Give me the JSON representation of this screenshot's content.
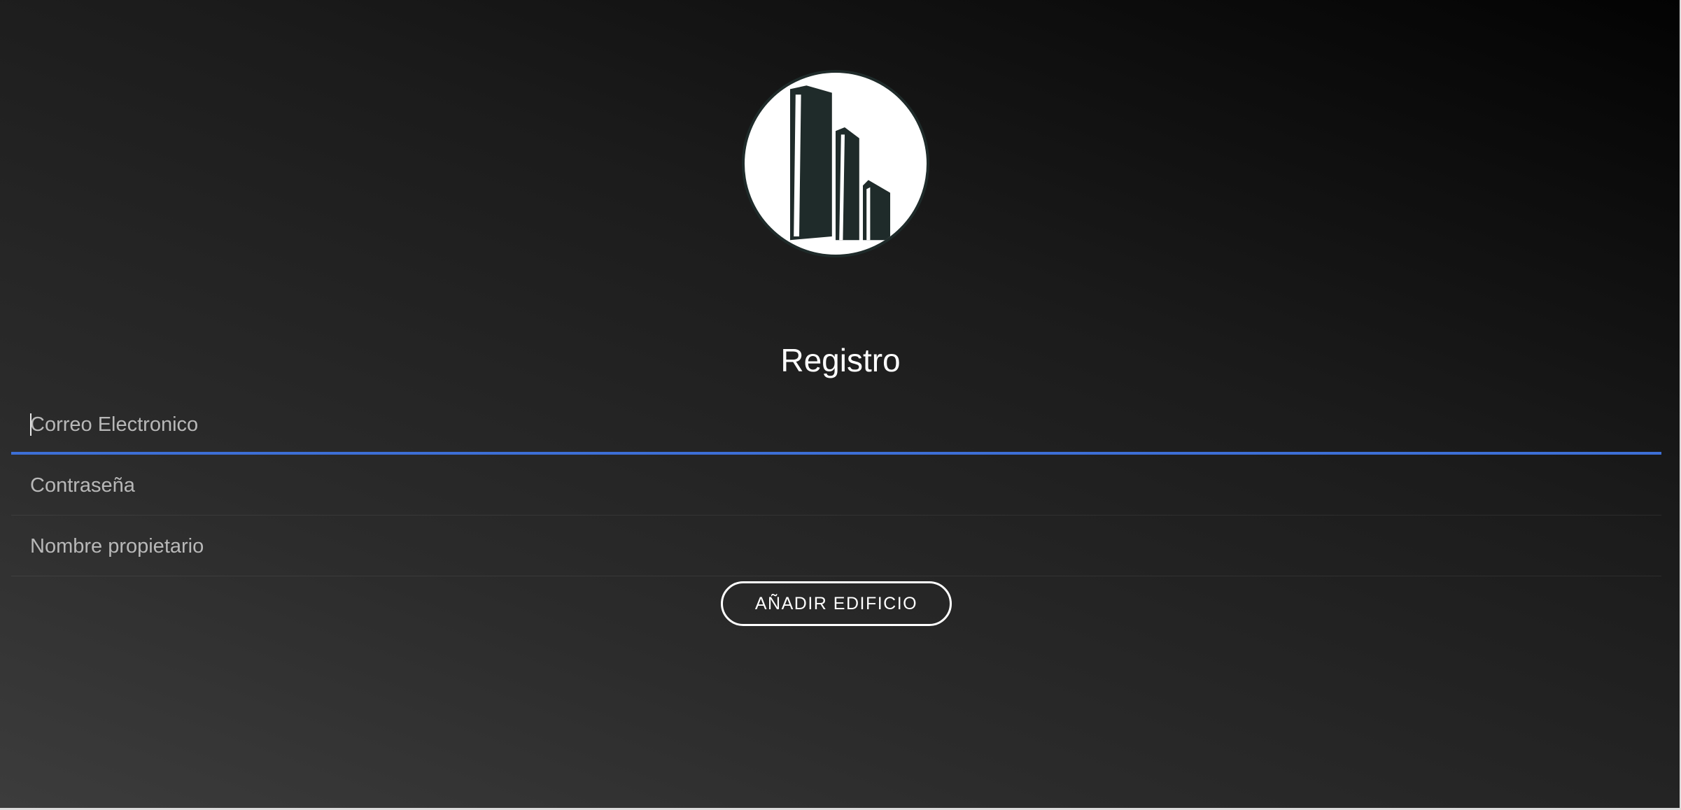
{
  "register": {
    "title": "Registro",
    "email_placeholder": "Correo Electronico",
    "password_placeholder": "Contraseña",
    "owner_placeholder": "Nombre propietario",
    "submit_label": "AÑADIR EDIFICIO"
  },
  "logo": {
    "icon": "building-icon"
  },
  "colors": {
    "focus_underline": "#3d6fd6",
    "logo_fill": "#1f2b2a"
  }
}
